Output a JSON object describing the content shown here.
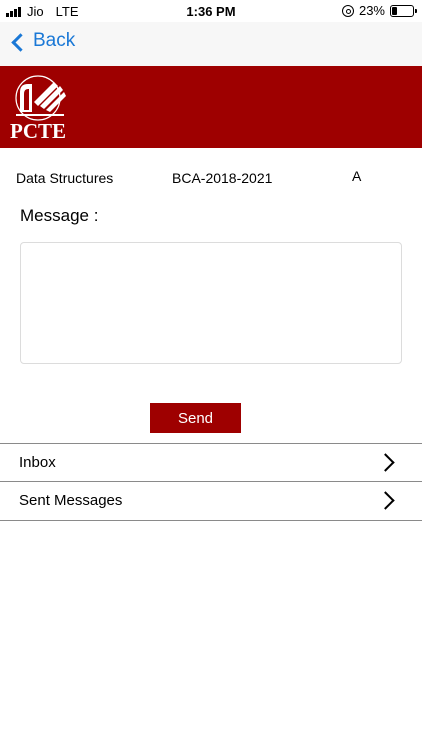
{
  "status_bar": {
    "carrier": "Jio",
    "network": "LTE",
    "time": "1:36 PM",
    "battery_percent": "23%",
    "battery_level": 0.23
  },
  "nav": {
    "back_label": "Back"
  },
  "header": {
    "logo_text": "PCTE",
    "brand_color": "#9e0000"
  },
  "course": {
    "subject": "Data Structures",
    "batch": "BCA-2018-2021",
    "section": "A"
  },
  "message": {
    "label": "Message :",
    "value": ""
  },
  "send_label": "Send",
  "list": {
    "inbox_label": "Inbox",
    "sent_label": "Sent Messages"
  }
}
